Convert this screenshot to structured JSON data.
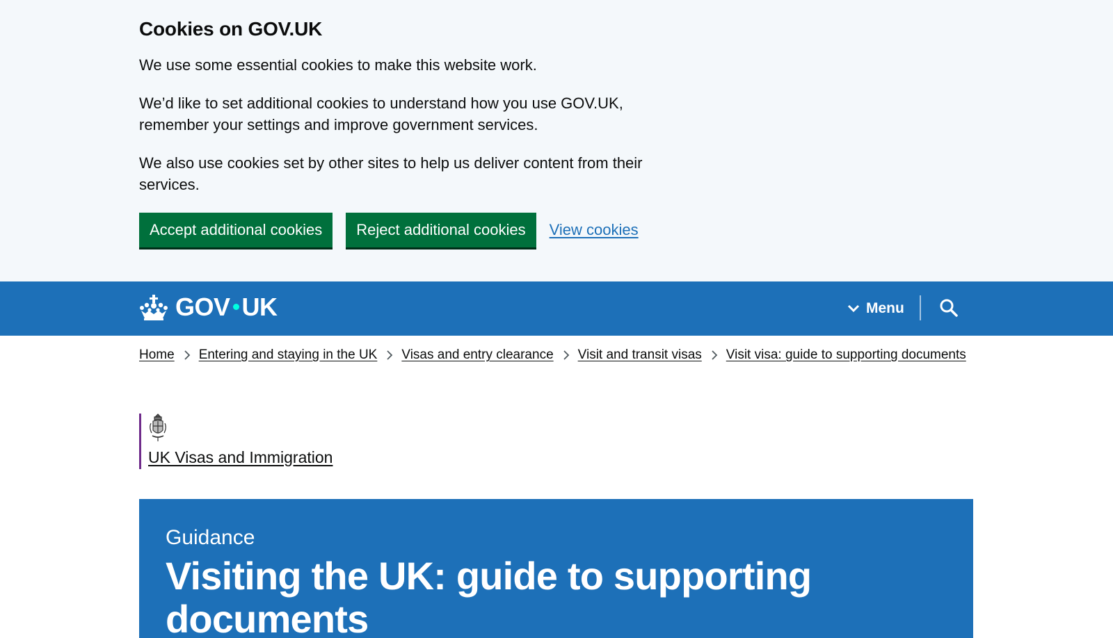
{
  "cookie_banner": {
    "title": "Cookies on GOV.UK",
    "paragraph_1": "We use some essential cookies to make this website work.",
    "paragraph_2_line_1": "We’d like to set additional cookies to understand how you use GOV.UK,",
    "paragraph_2_line_2": "remember your settings and improve government services.",
    "paragraph_3_line_1": "We also use cookies set by other sites to help us deliver content from their",
    "paragraph_3_line_2": "services.",
    "accept_label": "Accept additional cookies",
    "reject_label": "Reject additional cookies",
    "view_label": "View cookies",
    "button_color": "#00703c"
  },
  "header": {
    "logo_left": "GOV",
    "logo_right": "UK",
    "menu_label": "Menu",
    "search_icon": "search-icon",
    "background_color": "#1d70b8"
  },
  "breadcrumbs": [
    "Home",
    "Entering and staying in the UK",
    "Visas and entry clearance",
    "Visit and transit visas",
    "Visit visa: guide to supporting documents"
  ],
  "organisation": {
    "name": "UK Visas and Immigration",
    "border_color": "#6f2b8a"
  },
  "guidance": {
    "label": "Guidance",
    "title": "Visiting the UK: guide to supporting documents"
  }
}
